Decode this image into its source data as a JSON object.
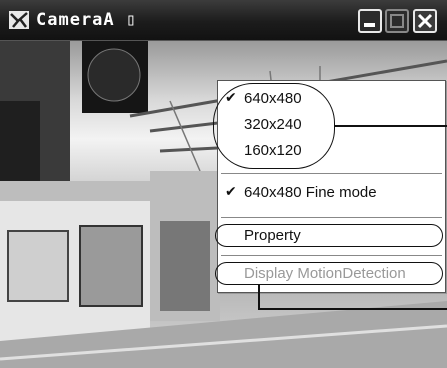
{
  "window": {
    "title": "CameraA",
    "title_box_glyph": "▯",
    "icon": "camera-app-icon",
    "controls": [
      "minimize-icon",
      "maximize-icon",
      "close-icon"
    ]
  },
  "context_menu": {
    "resolution_group": [
      {
        "label": "640x480",
        "checked": true
      },
      {
        "label": "320x240",
        "checked": false
      },
      {
        "label": "160x120",
        "checked": false
      }
    ],
    "fine_mode": {
      "label": "640x480 Fine mode",
      "checked": true
    },
    "property": {
      "label": "Property"
    },
    "motion_detection": {
      "label": "Display MotionDetection",
      "enabled": false
    },
    "check_glyph": "✔"
  }
}
